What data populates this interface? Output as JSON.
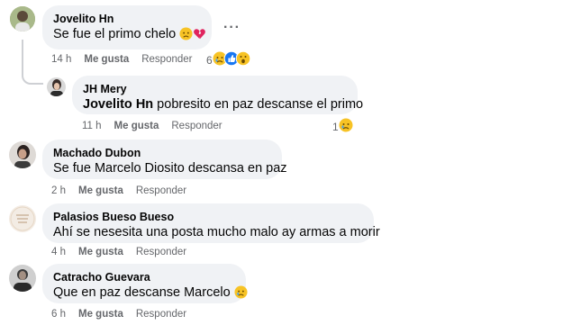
{
  "comments": [
    {
      "author": "Jovelito Hn",
      "text": "Se fue el primo chelo",
      "time": "14 h",
      "like": "Me gusta",
      "reply": "Responder",
      "reaction_count": "6"
    },
    {
      "author": "JH Mery",
      "mention": "Jovelito Hn",
      "text": " pobresito en paz descanse el primo",
      "time": "11 h",
      "like": "Me gusta",
      "reply": "Responder",
      "reaction_count": "1"
    },
    {
      "author": "Machado Dubon",
      "text": "Se fue Marcelo Diosito descansa en paz",
      "time": "2 h",
      "like": "Me gusta",
      "reply": "Responder"
    },
    {
      "author": "Palasios Bueso Bueso",
      "text": "Ahí se nesesita una posta mucho malo ay armas a morir",
      "time": "4 h",
      "like": "Me gusta",
      "reply": "Responder"
    },
    {
      "author": "Catracho Guevara",
      "text": "Que en paz descanse Marcelo",
      "time": "6 h",
      "like": "Me gusta",
      "reply": "Responder"
    }
  ],
  "more_options": "···",
  "colors": {
    "bubble": "#f0f2f5",
    "meta": "#65676b",
    "like_blue": "#1877f2",
    "emoji_yellow": "#f7c325",
    "heart_red": "#e0245e"
  },
  "icons": [
    "sad-emoji-icon",
    "broken-heart-icon",
    "like-reaction-icon",
    "wow-reaction-icon",
    "more-options-icon"
  ]
}
